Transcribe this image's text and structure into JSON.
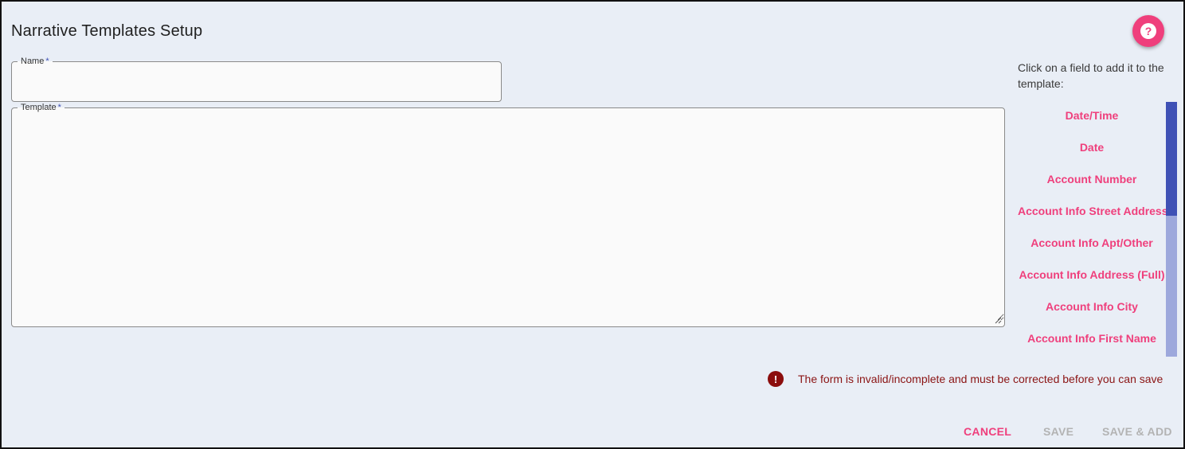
{
  "page": {
    "title": "Narrative Templates Setup"
  },
  "help": {
    "icon": "help-icon",
    "glyph": "?"
  },
  "form": {
    "name": {
      "label": "Name",
      "required_marker": "*",
      "value": "",
      "placeholder": ""
    },
    "template": {
      "label": "Template",
      "required_marker": "*",
      "value": "",
      "placeholder": ""
    }
  },
  "fields_panel": {
    "hint": "Click on a field to add it to the template:",
    "items": [
      "Date/Time",
      "Date",
      "Account Number",
      "Account Info Street Address",
      "Account Info Apt/Other",
      "Account Info Address (Full)",
      "Account Info City",
      "Account Info First Name"
    ]
  },
  "validation": {
    "icon": "error-icon",
    "glyph": "!",
    "message": "The form is invalid/incomplete and must be corrected before you can save"
  },
  "actions": {
    "cancel": "CANCEL",
    "save": "SAVE",
    "save_and_add": "SAVE & ADD"
  },
  "colors": {
    "accent": "#ef3f7c",
    "primary": "#3f51b5",
    "error": "#8b1414",
    "background": "#e9eef6"
  }
}
